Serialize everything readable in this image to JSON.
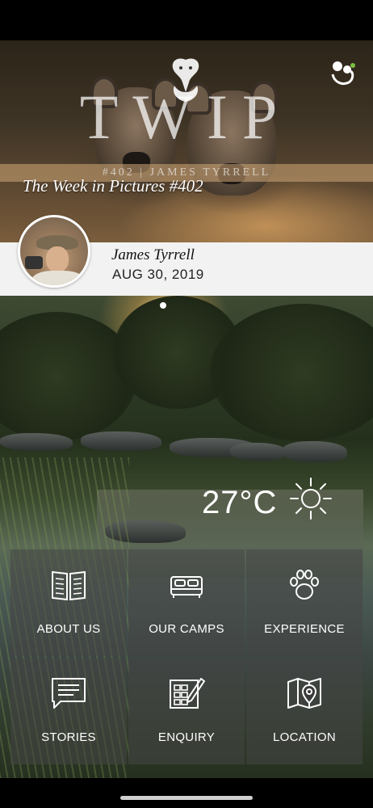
{
  "hero": {
    "logo": "TWIP",
    "band_text": "#402 | JAMES TYRRELL",
    "title": "The Week in Pictures #402"
  },
  "author": {
    "name": "James Tyrrell",
    "date": "AUG 30, 2019"
  },
  "weather": {
    "temperature": "27°C",
    "condition_icon": "sun-icon"
  },
  "menu": [
    {
      "label": "ABOUT US",
      "icon": "book-icon"
    },
    {
      "label": "OUR CAMPS",
      "icon": "bed-icon"
    },
    {
      "label": "EXPERIENCE",
      "icon": "paw-icon"
    },
    {
      "label": "STORIES",
      "icon": "chat-icon"
    },
    {
      "label": "ENQUIRY",
      "icon": "form-pencil-icon"
    },
    {
      "label": "LOCATION",
      "icon": "map-pin-icon"
    }
  ]
}
